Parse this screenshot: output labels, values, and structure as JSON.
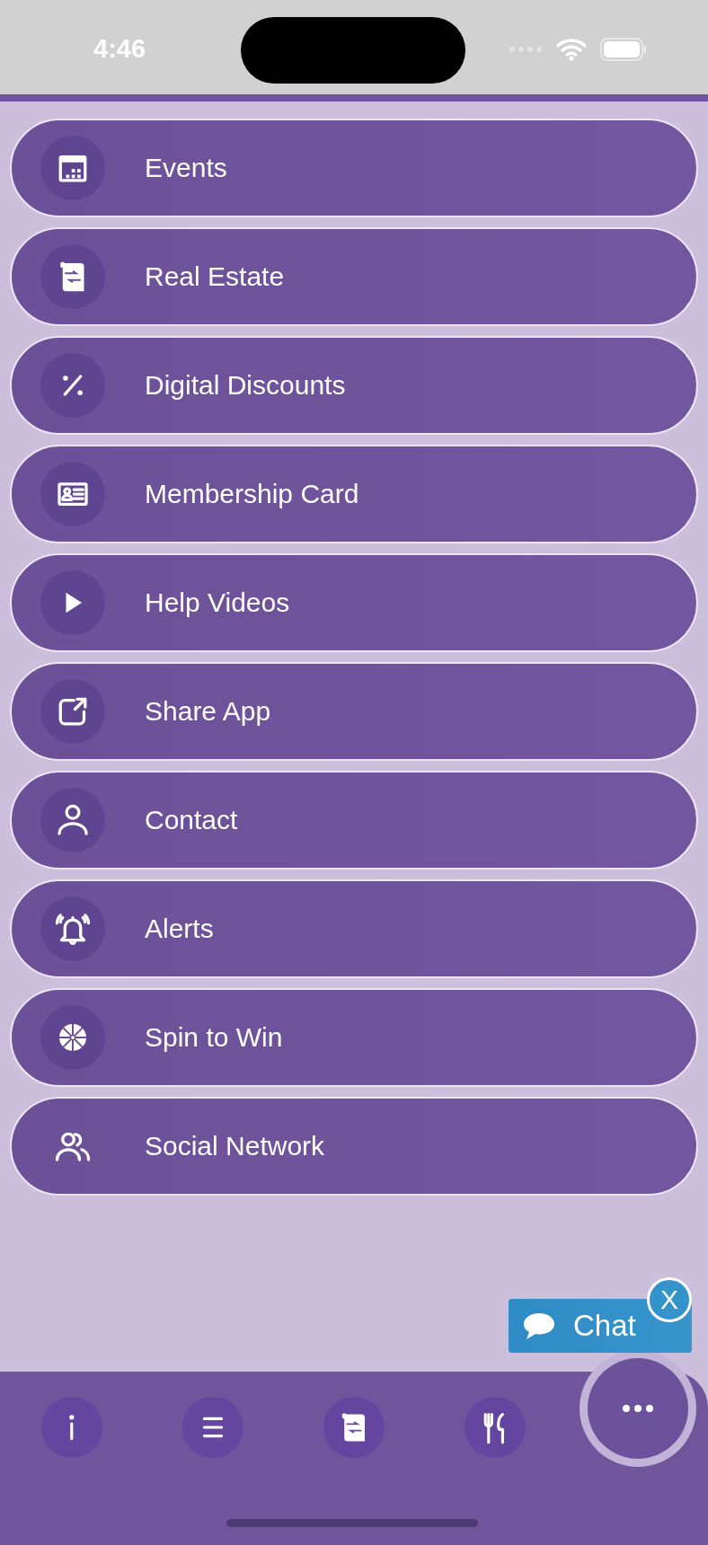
{
  "status_bar": {
    "time": "4:46"
  },
  "menu_items": [
    {
      "label": "Events",
      "icon_backdrop": true
    },
    {
      "label": "Real Estate",
      "icon_backdrop": true
    },
    {
      "label": "Digital Discounts",
      "icon_backdrop": true
    },
    {
      "label": "Membership Card",
      "icon_backdrop": true
    },
    {
      "label": "Help Videos",
      "icon_backdrop": true
    },
    {
      "label": "Share App",
      "icon_backdrop": true
    },
    {
      "label": "Contact",
      "icon_backdrop": true
    },
    {
      "label": "Alerts",
      "icon_backdrop": true
    },
    {
      "label": "Spin to Win",
      "icon_backdrop": true
    },
    {
      "label": "Social Network",
      "icon_backdrop": false
    }
  ],
  "chat": {
    "label": "Chat",
    "close_label": "X"
  }
}
